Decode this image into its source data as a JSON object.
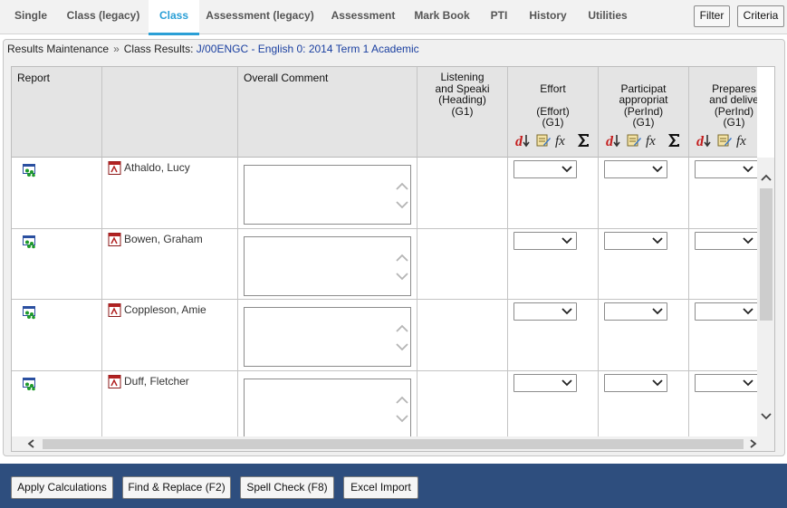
{
  "nav": {
    "tabs": [
      {
        "label": "Single"
      },
      {
        "label": "Class (legacy)"
      },
      {
        "label": "Class"
      },
      {
        "label": "Assessment (legacy)"
      },
      {
        "label": "Assessment"
      },
      {
        "label": "Mark Book"
      },
      {
        "label": "PTI"
      },
      {
        "label": "History"
      },
      {
        "label": "Utilities"
      }
    ],
    "active_tab": "Class",
    "filter_label": "Filter",
    "criteria_label": "Criteria"
  },
  "breadcrumb": {
    "root": "Results Maintenance",
    "separator": "»",
    "current_prefix": "Class Results:",
    "current_class": "J/00ENGC - English 0: 2014 Term 1 Academic"
  },
  "grid": {
    "columns": [
      {
        "header": "Report"
      },
      {
        "header": ""
      },
      {
        "header": "Overall Comment"
      },
      {
        "header": "Listening\nand Speaki\n(Heading)\n(G1)"
      },
      {
        "header": "Effort\n\n(Effort)\n(G1)"
      },
      {
        "header": "Participat\nappropriat\n(PerInd)\n(G1)"
      },
      {
        "header": "Prepares\nand delive\n(PerInd)\n(G1)"
      }
    ],
    "students": [
      {
        "name": "Athaldo, Lucy"
      },
      {
        "name": "Bowen, Graham"
      },
      {
        "name": "Coppleson, Amie"
      },
      {
        "name": "Duff, Fletcher"
      }
    ],
    "header_icons": [
      "sort-down-icon",
      "edit-notes-icon",
      "formula-fx-icon",
      "sum-sigma-icon"
    ]
  },
  "footer": {
    "apply_calculations": "Apply Calculations",
    "find_replace": "Find & Replace (F2)",
    "spell_check": "Spell Check (F8)",
    "excel_import": "Excel Import"
  },
  "colors": {
    "accent": "#2a9fd6",
    "footer_bg": "#2e4e7e",
    "class_link": "#1a3fa0"
  }
}
